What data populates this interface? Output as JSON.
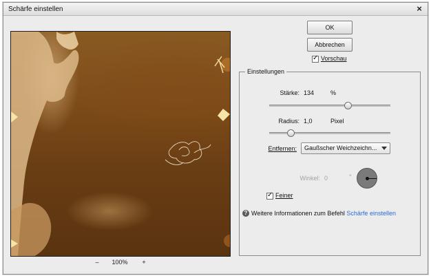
{
  "window": {
    "title": "Schärfe einstellen",
    "close_label": "×"
  },
  "zoom": {
    "minus": "–",
    "value": "100%",
    "plus": "+"
  },
  "buttons": {
    "ok": "OK",
    "cancel": "Abbrechen"
  },
  "preview_toggle": {
    "label": "Vorschau",
    "checked": true
  },
  "settings": {
    "legend": "Einstellungen",
    "amount": {
      "label": "Stärke:",
      "value": "134",
      "unit": "%",
      "slider_fraction": 0.66
    },
    "radius": {
      "label": "Radius:",
      "value": "1,0",
      "unit": "Pixel",
      "slider_fraction": 0.16
    },
    "remove": {
      "label": "Entfernen:",
      "selected": "Gaußscher Weichzeichn..."
    },
    "angle": {
      "label": "Winkel:",
      "value": "0",
      "unit": "°"
    },
    "finer": {
      "label": "Feiner",
      "checked": true
    }
  },
  "help": {
    "icon": "?",
    "text": "Weitere Informationen zum Befehl",
    "link": "Schärfe einstellen"
  },
  "colors": {
    "link": "#2a6bd6",
    "dialog_bg": "#ececec"
  },
  "icons": {
    "close": "close-icon",
    "help": "help-icon",
    "dropdown": "chevron-down-icon",
    "angle": "angle-dial-icon"
  }
}
